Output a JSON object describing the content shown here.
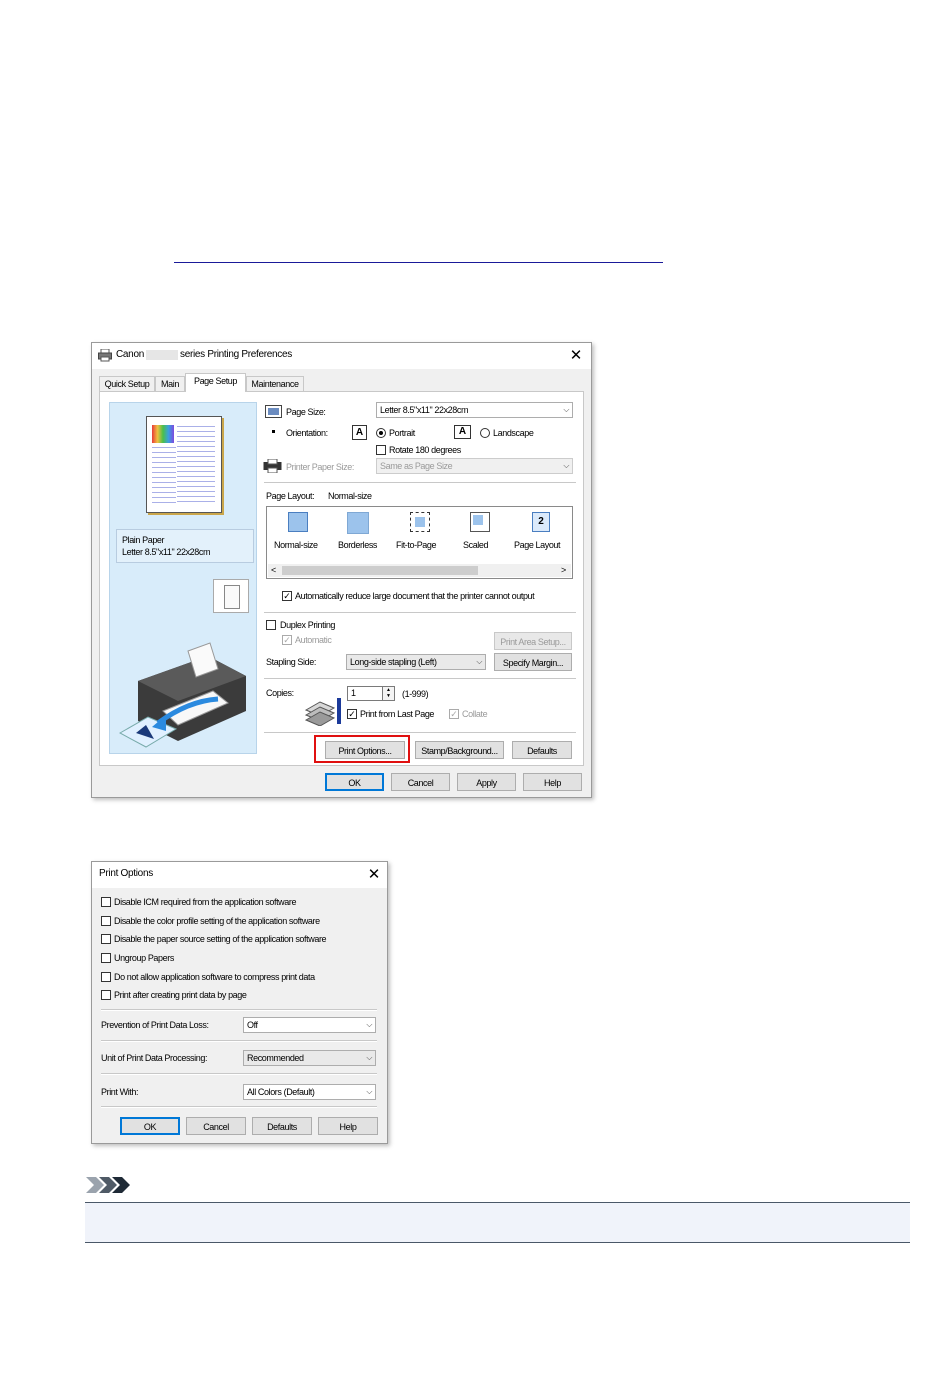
{
  "prefs_window": {
    "title_prefix": "Canon",
    "title_suffix": "series Printing Preferences",
    "close_glyph": "✕",
    "tabs": [
      {
        "label": "Quick Setup"
      },
      {
        "label": "Main"
      },
      {
        "label": "Page Setup",
        "active": true
      },
      {
        "label": "Maintenance"
      }
    ],
    "preview": {
      "media_line1": "Plain Paper",
      "media_line2": "Letter 8.5\"x11\" 22x28cm"
    },
    "page_size": {
      "label": "Page Size:",
      "value": "Letter 8.5\"x11\" 22x28cm"
    },
    "orientation": {
      "label": "Orientation:",
      "icon_glyph": "A",
      "portrait": "Portrait",
      "landscape": "Landscape",
      "rotate": "Rotate 180 degrees",
      "selected": "portrait"
    },
    "printer_paper_size": {
      "label": "Printer Paper Size:",
      "value": "Same as Page Size"
    },
    "page_layout": {
      "label": "Page Layout:",
      "value": "Normal-size",
      "options": [
        {
          "label": "Normal-size"
        },
        {
          "label": "Borderless"
        },
        {
          "label": "Fit-to-Page"
        },
        {
          "label": "Scaled"
        },
        {
          "label": "Page Layout",
          "glyph": "2"
        }
      ],
      "scroll_left": "<",
      "scroll_right": ">"
    },
    "auto_reduce": {
      "label": "Automatically reduce large document that the printer cannot output",
      "checked": true
    },
    "duplex": {
      "label": "Duplex Printing",
      "checked": false
    },
    "automatic": {
      "label": "Automatic",
      "checked": true
    },
    "print_area_setup": "Print Area Setup...",
    "stapling": {
      "label": "Stapling Side:",
      "value": "Long-side stapling (Left)"
    },
    "specify_margin": "Specify Margin...",
    "copies": {
      "label": "Copies:",
      "value": "1",
      "range": "(1-999)"
    },
    "print_from_last": {
      "label": "Print from Last Page",
      "checked": true
    },
    "collate": {
      "label": "Collate",
      "checked": true
    },
    "print_options_btn": "Print Options...",
    "stamp_btn": "Stamp/Background...",
    "defaults_btn": "Defaults",
    "ok": "OK",
    "cancel": "Cancel",
    "apply": "Apply",
    "help": "Help",
    "highlight_color": "#e01010"
  },
  "options_window": {
    "title": "Print Options",
    "close_glyph": "✕",
    "checkboxes": [
      {
        "label": "Disable ICM required from the application software"
      },
      {
        "label": "Disable the color profile setting of the application software"
      },
      {
        "label": "Disable the paper source setting of the application software"
      },
      {
        "label": "Ungroup Papers"
      },
      {
        "label": "Do not allow application software to compress print data"
      },
      {
        "label": "Print after creating print data by page"
      }
    ],
    "prevention": {
      "label": "Prevention of Print Data Loss:",
      "value": "Off"
    },
    "unit": {
      "label": "Unit of Print Data Processing:",
      "value": "Recommended"
    },
    "print_with": {
      "label": "Print With:",
      "value": "All Colors (Default)"
    },
    "ok": "OK",
    "cancel": "Cancel",
    "defaults": "Defaults",
    "help": "Help"
  },
  "note_icon": "note-icon"
}
